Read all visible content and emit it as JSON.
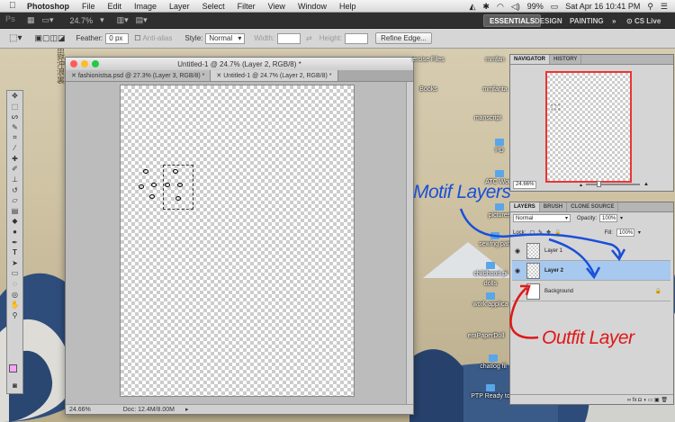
{
  "menubar": {
    "app": "Photoshop",
    "items": [
      "File",
      "Edit",
      "Image",
      "Layer",
      "Select",
      "Filter",
      "View",
      "Window",
      "Help"
    ],
    "battery": "99%",
    "clock": "Sat Apr 16  10:41 PM"
  },
  "appbar": {
    "logo": "Ps",
    "zoom": "24.7%",
    "workspaces": [
      "ESSENTIALS",
      "DESIGN",
      "PAINTING"
    ],
    "overflow": "»",
    "cs_live": "CS Live"
  },
  "options": {
    "feather_label": "Feather:",
    "feather_value": "0 px",
    "antialias_label": "Anti-alias",
    "style_label": "Style:",
    "style_value": "Normal",
    "width_label": "Width:",
    "height_label": "Height:",
    "refine_label": "Refine Edge..."
  },
  "document": {
    "title": "Untitled-1 @ 24.7% (Layer 2, RGB/8) *",
    "tabs": [
      "fashionistsa.psd @ 27.3% (Layer 3, RGB/8) *",
      "Untitled-1 @ 24.7% (Layer 2, RGB/8) *"
    ],
    "zoom": "24.66%",
    "doc_info": "Doc: 12.4M/8.00M"
  },
  "desktop_icons": [
    {
      "label": "ercise Files"
    },
    {
      "label": "mmfan"
    },
    {
      "label": "Books"
    },
    {
      "label": "mmfanta"
    },
    {
      "label": "manscript"
    },
    {
      "label": "PD"
    },
    {
      "label": "ATC Work"
    },
    {
      "label": "pictures"
    },
    {
      "label": "sewing patt"
    },
    {
      "label": "childhood pi"
    },
    {
      "label": "dolls"
    },
    {
      "label": "work applica"
    },
    {
      "label": "eraPaperDoll"
    },
    {
      "label": "chatlog fil"
    },
    {
      "label": "PTP Ready to"
    }
  ],
  "navigator": {
    "tabs": [
      "NAVIGATOR",
      "HISTORY"
    ],
    "zoom": "24.66%"
  },
  "layers": {
    "tabs": [
      "LAYERS",
      "BRUSH",
      "CLONE SOURCE"
    ],
    "blend_mode": "Normal",
    "opacity_label": "Opacity:",
    "opacity_value": "100%",
    "lock_label": "Lock:",
    "fill_label": "Fill:",
    "fill_value": "100%",
    "rows": [
      {
        "name": "Layer 1"
      },
      {
        "name": "Layer 2"
      },
      {
        "name": "Background"
      }
    ],
    "footer_icons": "∞  fx  ◘  ◑  ▭  ▣  🗑"
  },
  "annotations": {
    "motif": "Motif Layers",
    "outfit": "Outfit Layer"
  },
  "colors": {
    "foreground_swatch": "#f7a4f4",
    "annotation_blue": "#1a4fd8",
    "annotation_red": "#e01818",
    "selected_layer": "#a7c8ef"
  }
}
